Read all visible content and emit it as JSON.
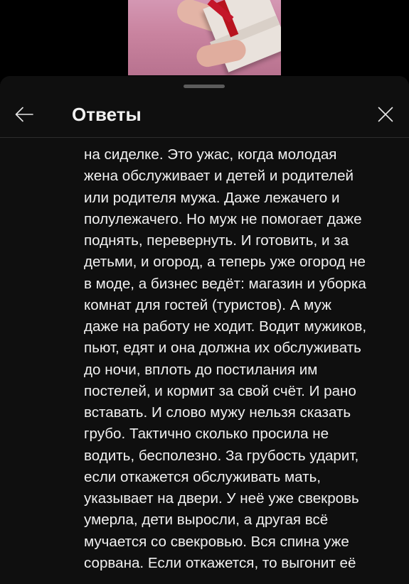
{
  "sheet": {
    "title": "Ответы"
  },
  "icons": {
    "back": "arrow-left-icon",
    "close": "close-icon"
  },
  "colors": {
    "background": "#0f0f0f",
    "text": "#f1f1f1",
    "divider": "#2c2c2c",
    "handle": "#5b5b5b"
  },
  "reply": {
    "lines": [
      "на сиделке. Это ужас, когда молодая",
      "жена обслуживает и детей и родителей",
      "или родителя мужа. Даже лежачего и",
      "полулежачего. Но муж не помогает даже",
      "поднять, перевернуть. И готовить, и за",
      "детьми, и огород, а теперь уже огород не",
      "в моде, а бизнес ведёт: магазин и уборка",
      "комнат для гостей (туристов). А муж",
      "даже на работу не ходит. Водит мужиков,",
      "пьют, едят и она должна их обслуживать",
      "до ночи, вплоть до постилания им",
      "постелей, и кормит за свой счёт. И рано",
      "вставать. И слово мужу нельзя сказать",
      "грубо. Тактично сколько просила не",
      "водить, бесполезно. За грубость ударит,",
      "если откажется обслуживать мать,",
      "указывает на двери. У неё уже свекровь",
      "умерла, дети выросли, а другая всё",
      "мучается со свекровью. Вся спина уже",
      "сорвана. Если откажется, то выгонит её"
    ]
  }
}
